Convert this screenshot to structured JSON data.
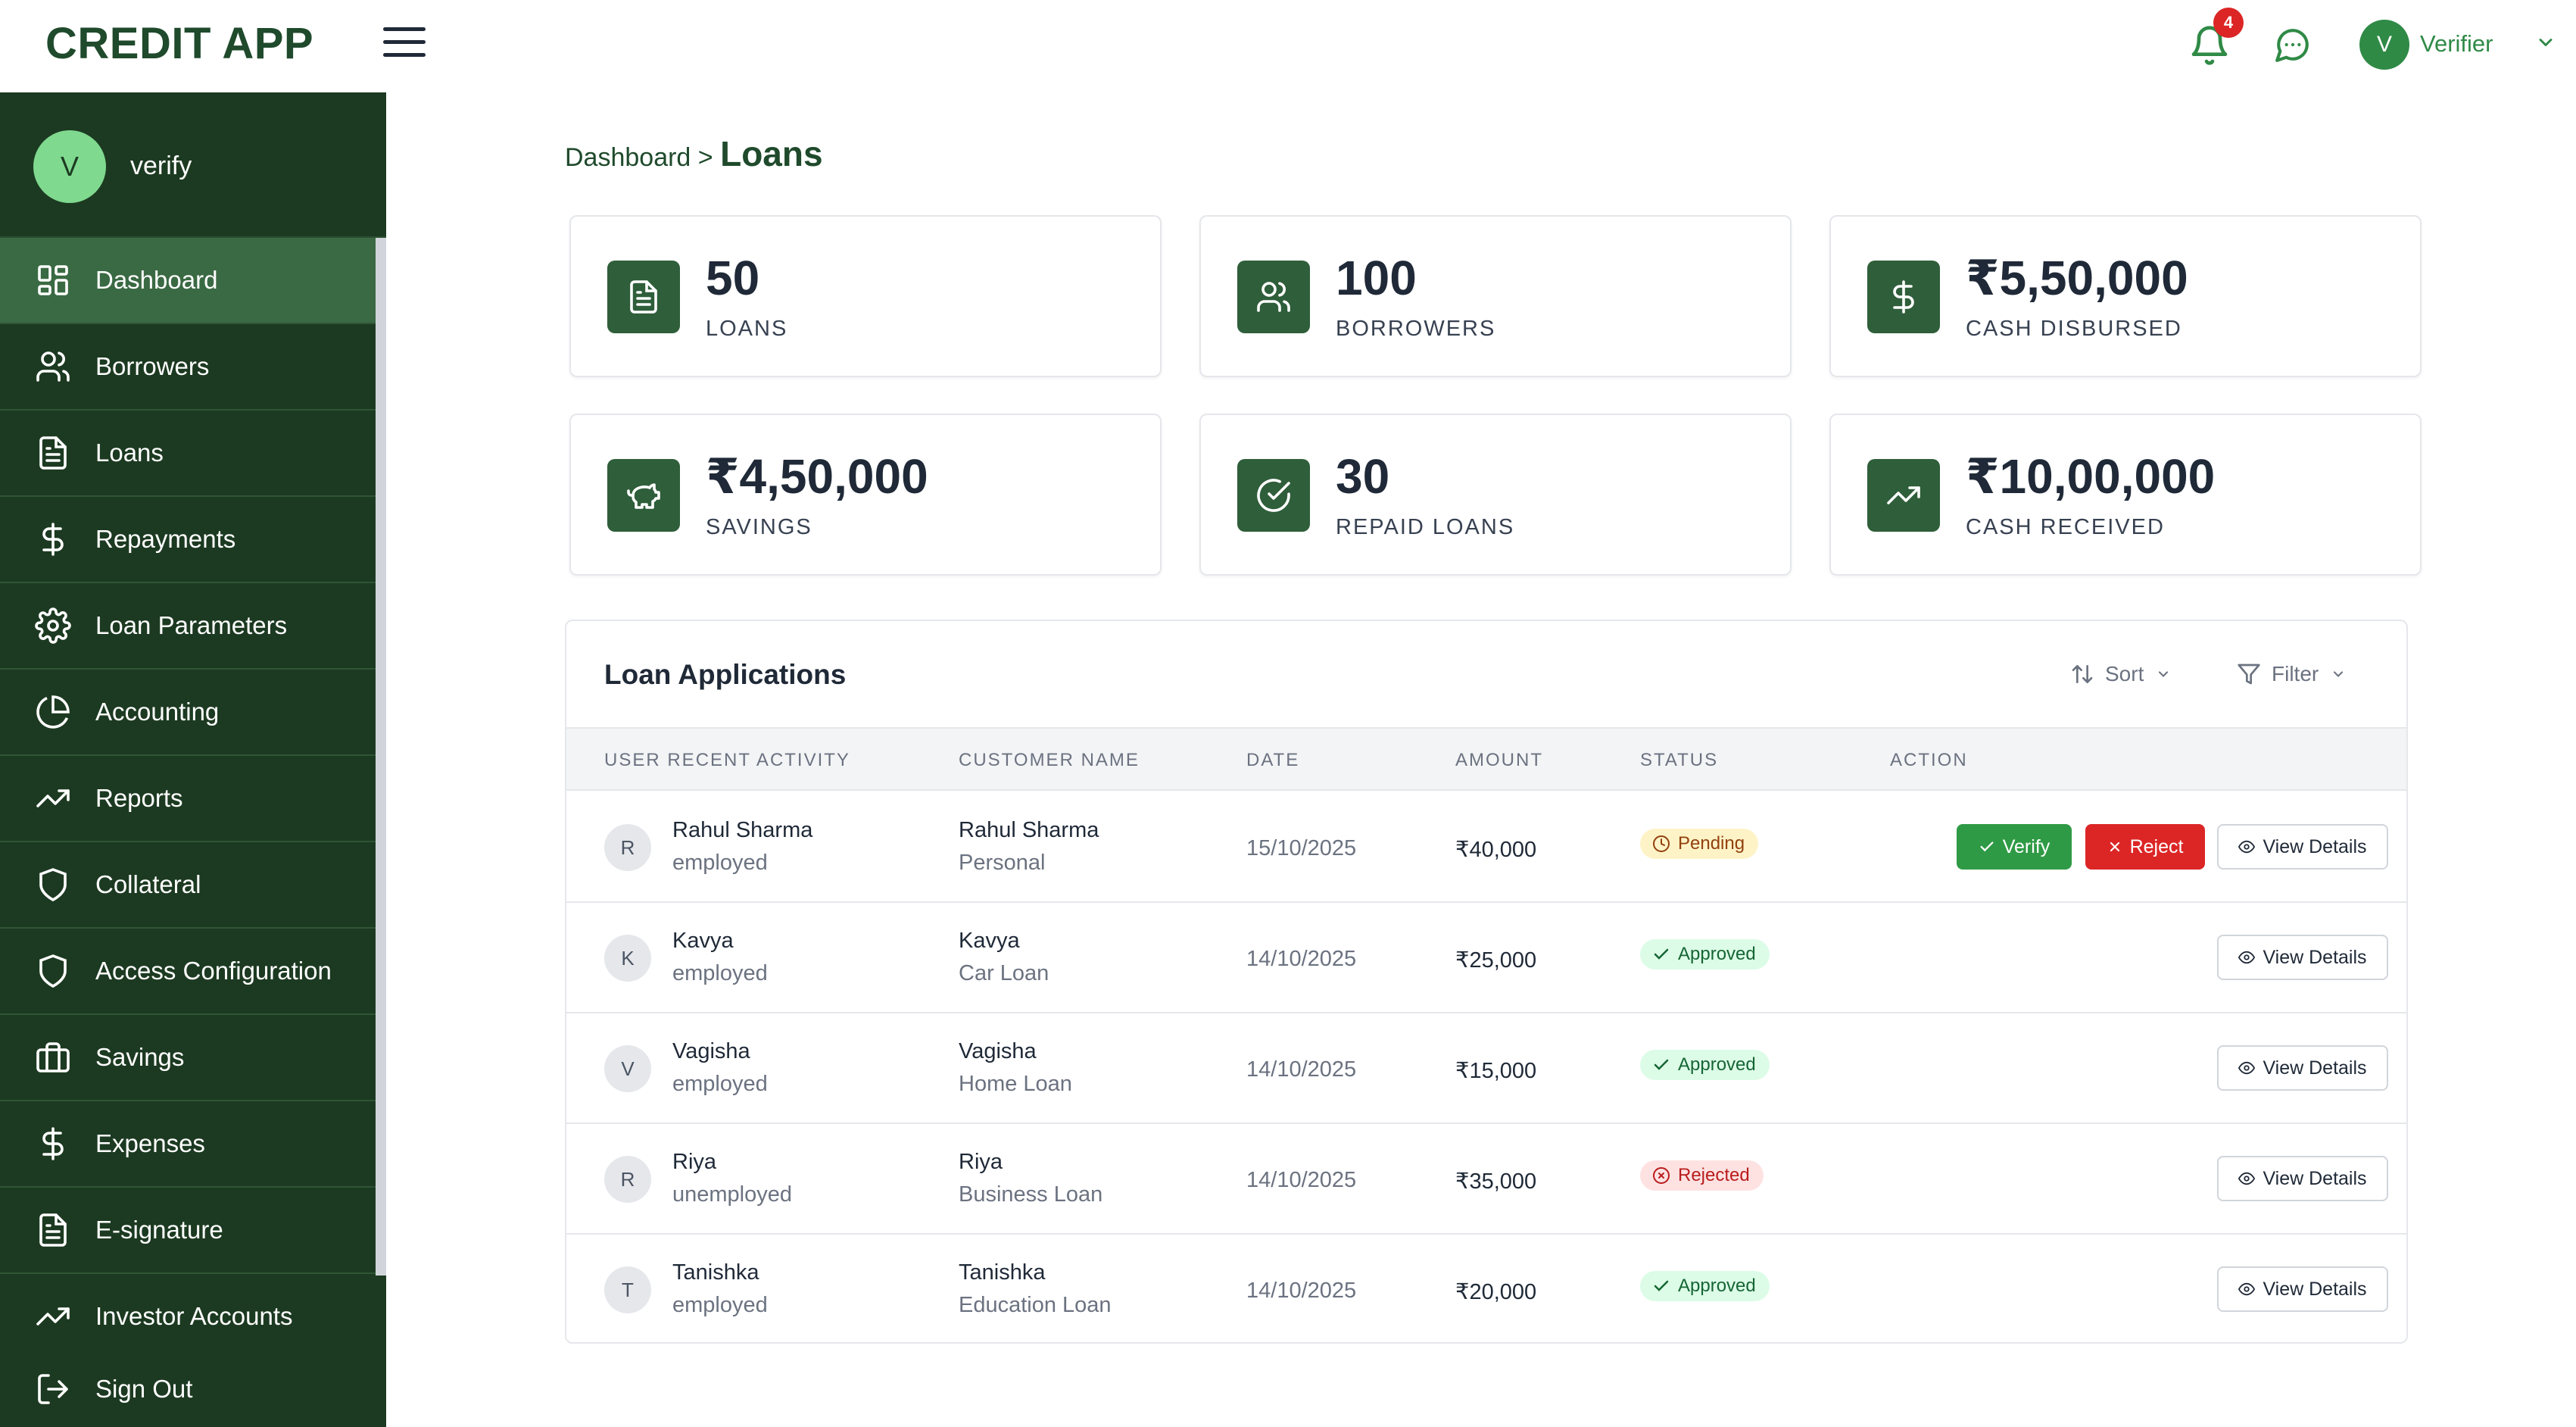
{
  "header": {
    "app_title": "CREDIT APP",
    "notification_count": "4",
    "user_initial": "V",
    "user_name": "Verifier"
  },
  "sidebar": {
    "profile_initial": "V",
    "profile_name": "verify",
    "items": [
      {
        "label": "Dashboard",
        "icon": "dashboard-icon",
        "active": true
      },
      {
        "label": "Borrowers",
        "icon": "users-icon"
      },
      {
        "label": "Loans",
        "icon": "document-icon"
      },
      {
        "label": "Repayments",
        "icon": "dollar-icon"
      },
      {
        "label": "Loan Parameters",
        "icon": "gear-icon"
      },
      {
        "label": "Accounting",
        "icon": "pie-chart-icon"
      },
      {
        "label": "Reports",
        "icon": "trend-up-icon"
      },
      {
        "label": "Collateral",
        "icon": "shield-icon"
      },
      {
        "label": "Access Configuration",
        "icon": "shield-icon"
      },
      {
        "label": "Savings",
        "icon": "briefcase-icon"
      },
      {
        "label": "Expenses",
        "icon": "dollar-icon"
      },
      {
        "label": "E-signature",
        "icon": "document-icon"
      },
      {
        "label": "Investor Accounts",
        "icon": "trend-up-icon"
      }
    ],
    "sign_out": "Sign Out"
  },
  "breadcrumb": {
    "parent": "Dashboard",
    "separator": ">",
    "current": "Loans"
  },
  "stats": [
    {
      "value": "50",
      "label": "LOANS",
      "icon": "document-icon"
    },
    {
      "value": "100",
      "label": "BORROWERS",
      "icon": "users-icon"
    },
    {
      "value": "₹5,50,000",
      "label": "CASH DISBURSED",
      "icon": "dollar-icon"
    },
    {
      "value": "₹4,50,000",
      "label": "SAVINGS",
      "icon": "piggy-bank-icon"
    },
    {
      "value": "30",
      "label": "REPAID LOANS",
      "icon": "check-circle-icon"
    },
    {
      "value": "₹10,00,000",
      "label": "CASH RECEIVED",
      "icon": "trend-up-icon"
    }
  ],
  "table": {
    "title": "Loan Applications",
    "sort_label": "Sort",
    "filter_label": "Filter",
    "columns": [
      "USER RECENT ACTIVITY",
      "CUSTOMER NAME",
      "DATE",
      "AMOUNT",
      "STATUS",
      "ACTION"
    ],
    "verify_label": "Verify",
    "reject_label": "Reject",
    "view_label": "View Details",
    "rows": [
      {
        "initial": "R",
        "user": "Rahul Sharma",
        "employment": "employed",
        "customer": "Rahul Sharma",
        "loan_type": "Personal",
        "date": "15/10/2025",
        "amount": "₹40,000",
        "status": "Pending"
      },
      {
        "initial": "K",
        "user": "Kavya",
        "employment": "employed",
        "customer": "Kavya",
        "loan_type": "Car Loan",
        "date": "14/10/2025",
        "amount": "₹25,000",
        "status": "Approved"
      },
      {
        "initial": "V",
        "user": "Vagisha",
        "employment": "employed",
        "customer": "Vagisha",
        "loan_type": "Home Loan",
        "date": "14/10/2025",
        "amount": "₹15,000",
        "status": "Approved"
      },
      {
        "initial": "R",
        "user": "Riya",
        "employment": "unemployed",
        "customer": "Riya",
        "loan_type": "Business Loan",
        "date": "14/10/2025",
        "amount": "₹35,000",
        "status": "Rejected"
      },
      {
        "initial": "T",
        "user": "Tanishka",
        "employment": "employed",
        "customer": "Tanishka",
        "loan_type": "Education Loan",
        "date": "14/10/2025",
        "amount": "₹20,000",
        "status": "Approved"
      }
    ]
  },
  "colors": {
    "brand_dark": "#1c3a21",
    "brand_title": "#1f4a2c",
    "icon_tile": "#2f5e3a",
    "verify": "#2f9a45",
    "reject": "#dc2626"
  }
}
